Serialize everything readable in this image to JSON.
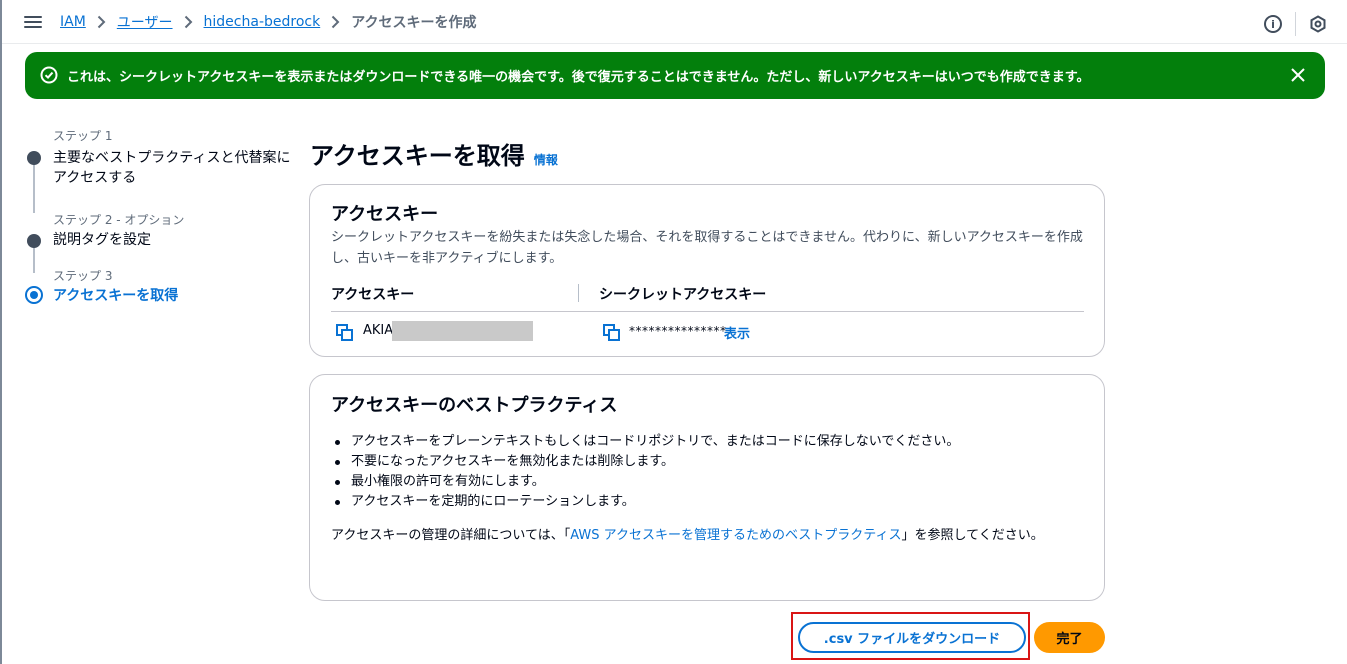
{
  "breadcrumb": {
    "items": [
      "IAM",
      "ユーザー",
      "hidecha-bedrock"
    ],
    "current": "アクセスキーを作成"
  },
  "flash": {
    "message": "これは、シークレットアクセスキーを表示またはダウンロードできる唯一の機会です。後で復元することはできません。ただし、新しいアクセスキーはいつでも作成できます。",
    "color": "#037f0c"
  },
  "steps": [
    {
      "label": "ステップ 1",
      "title": "主要なベストプラクティスと代替案にアクセスする"
    },
    {
      "label": "ステップ 2 - オプション",
      "title": "説明タグを設定"
    },
    {
      "label": "ステップ 3",
      "title": "アクセスキーを取得"
    }
  ],
  "page": {
    "title": "アクセスキーを取得",
    "info_link": "情報"
  },
  "access_key_card": {
    "title": "アクセスキー",
    "description": "シークレットアクセスキーを紛失または失念した場合、それを取得することはできません。代わりに、新しいアクセスキーを作成し、古いキーを非アクティブにします。",
    "col_access_key": "アクセスキー",
    "col_secret_key": "シークレットアクセスキー",
    "access_key_value": "AKIA",
    "secret_key_value": "***************",
    "show_label": "表示"
  },
  "best_practices_card": {
    "title": "アクセスキーのベストプラクティス",
    "items": [
      "アクセスキーをプレーンテキストもしくはコードリポジトリで、またはコードに保存しないでください。",
      "不要になったアクセスキーを無効化または削除します。",
      "最小権限の許可を有効にします。",
      "アクセスキーを定期的にローテーションします。"
    ],
    "footer_prefix": "アクセスキーの管理の詳細については、「",
    "footer_link": "AWS アクセスキーを管理するためのベストプラクティス",
    "footer_suffix": "」を参照してください。"
  },
  "actions": {
    "download_csv": ".csv ファイルをダウンロード",
    "done": "完了"
  },
  "colors": {
    "link": "#0972d3",
    "primary_button": "#ff9900",
    "highlight": "#d91515"
  }
}
